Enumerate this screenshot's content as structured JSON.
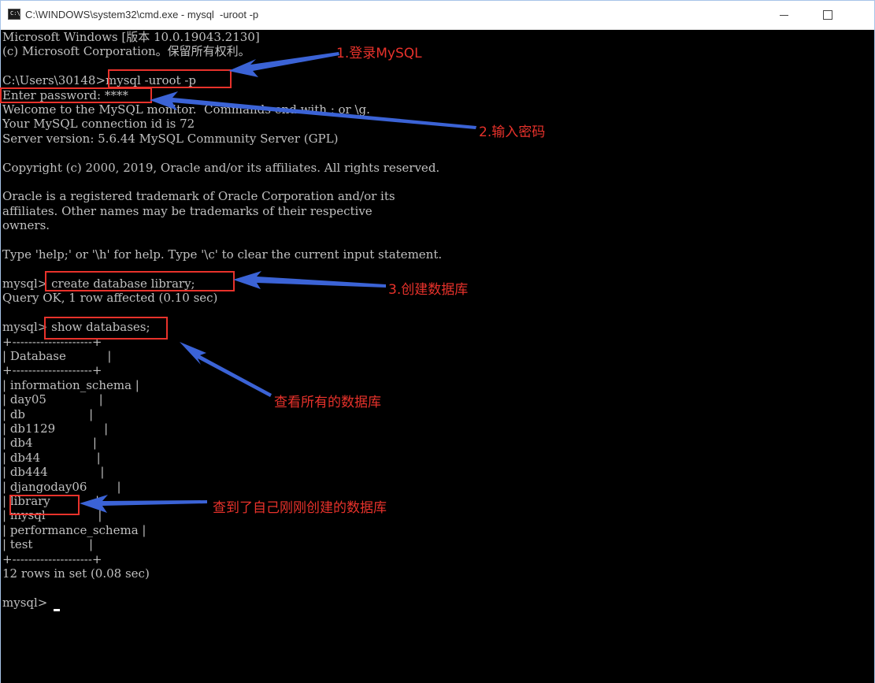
{
  "window": {
    "title": "C:\\WINDOWS\\system32\\cmd.exe - mysql  -uroot -p",
    "icon": "cmd-icon",
    "controls": [
      "minimize",
      "maximize"
    ]
  },
  "console": {
    "lines": [
      "Microsoft Windows [版本 10.0.19043.2130]",
      "(c) Microsoft Corporation。保留所有权利。",
      "",
      "C:\\Users\\30148>mysql -uroot -p",
      "Enter password: ****",
      "Welcome to the MySQL monitor.  Commands end with ; or \\g.",
      "Your MySQL connection id is 72",
      "Server version: 5.6.44 MySQL Community Server (GPL)",
      "",
      "Copyright (c) 2000, 2019, Oracle and/or its affiliates. All rights reserved.",
      "",
      "Oracle is a registered trademark of Oracle Corporation and/or its",
      "affiliates. Other names may be trademarks of their respective",
      "owners.",
      "",
      "Type 'help;' or '\\h' for help. Type '\\c' to clear the current input statement.",
      "",
      "mysql> create database library;",
      "Query OK, 1 row affected (0.10 sec)",
      "",
      "mysql> show databases;",
      "+--------------------+",
      "| Database           |",
      "+--------------------+",
      "| information_schema |",
      "| day05              |",
      "| db                 |",
      "| db1129             |",
      "| db4                |",
      "| db44               |",
      "| db444              |",
      "| djangoday06        |",
      "| library            |",
      "| mysql              |",
      "| performance_schema |",
      "| test               |",
      "+--------------------+",
      "12 rows in set (0.08 sec)",
      "",
      "mysql> "
    ]
  },
  "annotations": {
    "login": "1.登录MySQL",
    "password": "2.输入密码",
    "create_db": "3.创建数据库",
    "show_all": "查看所有的数据库",
    "found": "查到了自己刚刚创建的数据库"
  },
  "colors": {
    "console_bg": "#000000",
    "console_text": "#c0c0c0",
    "annotation": "#e8322b",
    "arrow": "#3b63d6"
  }
}
